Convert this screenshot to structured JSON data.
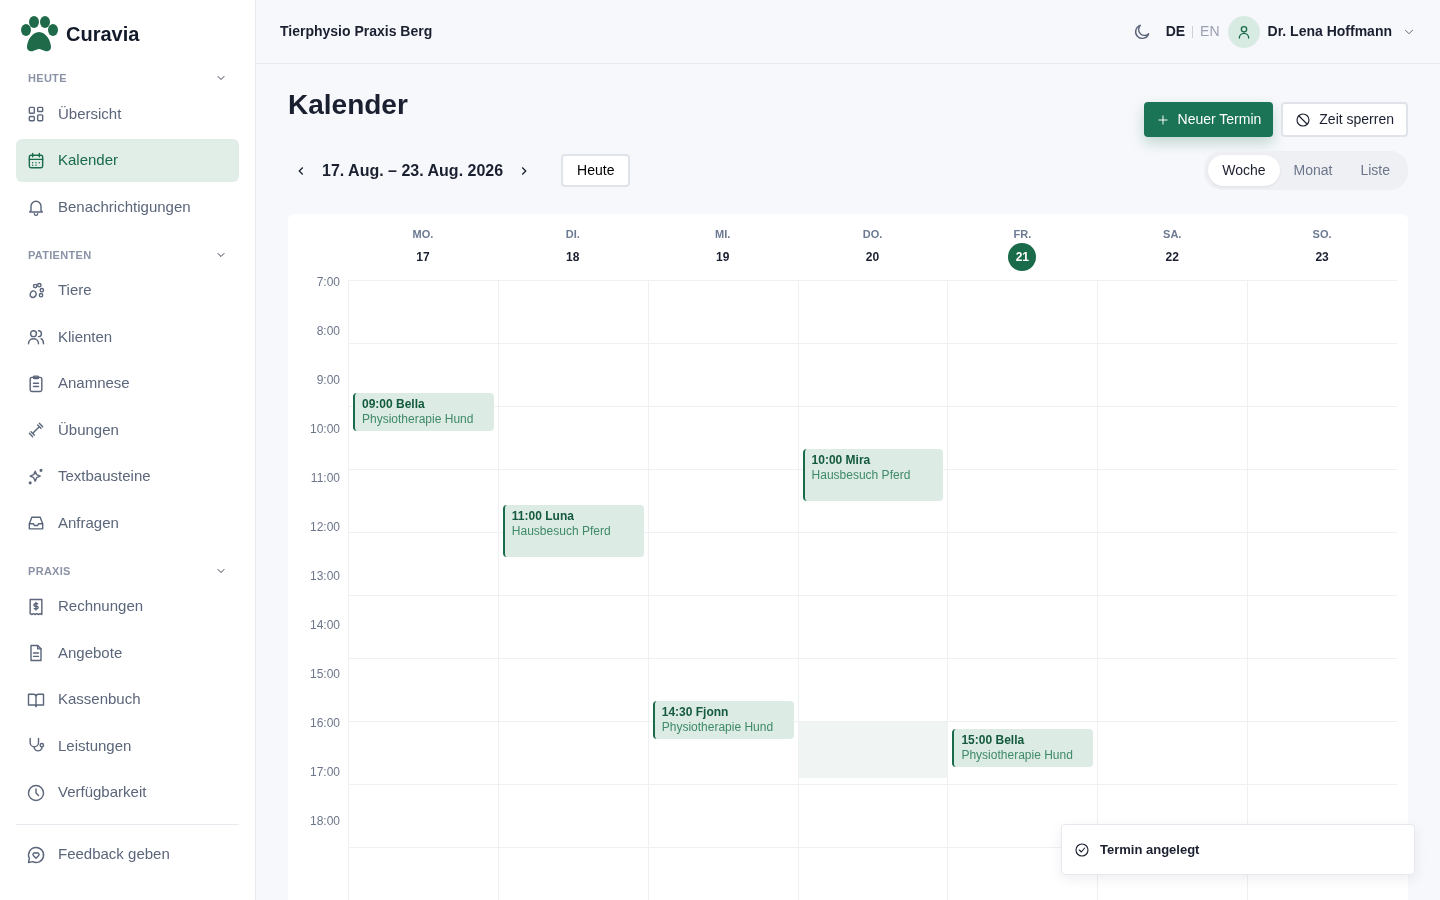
{
  "brand": {
    "name": "Curavia"
  },
  "sidebar": {
    "sections": [
      {
        "heading": "HEUTE",
        "expanded": true,
        "items": [
          {
            "label": "Übersicht",
            "selected": false
          },
          {
            "label": "Kalender",
            "selected": true
          },
          {
            "label": "Benachrichtigungen",
            "selected": false
          }
        ]
      },
      {
        "heading": "PATIENTEN",
        "expanded": true,
        "items": [
          {
            "label": "Tiere",
            "selected": false
          },
          {
            "label": "Klienten",
            "selected": false
          },
          {
            "label": "Anamnese",
            "selected": false
          },
          {
            "label": "Übungen",
            "selected": false
          },
          {
            "label": "Textbausteine",
            "selected": false
          },
          {
            "label": "Anfragen",
            "selected": false
          }
        ]
      },
      {
        "heading": "PRAXIS",
        "expanded": true,
        "items": [
          {
            "label": "Rechnungen",
            "selected": false
          },
          {
            "label": "Angebote",
            "selected": false
          },
          {
            "label": "Kassenbuch",
            "selected": false
          },
          {
            "label": "Leistungen",
            "selected": false
          },
          {
            "label": "Verfügbarkeit",
            "selected": false
          }
        ]
      }
    ],
    "footer_items": [
      {
        "label": "Feedback geben",
        "selected": false
      }
    ]
  },
  "header": {
    "practice": "Tierphysio Praxis Berg",
    "languages": [
      {
        "code": "DE",
        "selected": true
      },
      {
        "code": "EN",
        "selected": false
      }
    ],
    "user": "Dr. Lena Hoffmann"
  },
  "page": {
    "title": "Kalender",
    "actions": [
      {
        "label": "Neuer Termin",
        "kind": "primary"
      },
      {
        "label": "Zeit sperren",
        "kind": "outline"
      }
    ],
    "range": "17. Aug. – 23. Aug. 2026",
    "today_button": "Heute",
    "views": [
      {
        "label": "Woche",
        "selected": true
      },
      {
        "label": "Monat",
        "selected": false
      },
      {
        "label": "Liste",
        "selected": false
      }
    ]
  },
  "calendar": {
    "times": [
      "7:00",
      "8:00",
      "9:00",
      "10:00",
      "11:00",
      "12:00",
      "13:00",
      "14:00",
      "15:00",
      "16:00",
      "17:00",
      "18:00"
    ],
    "days": [
      {
        "name": "MO.",
        "date": "17",
        "today": false,
        "blocked": false,
        "events": [
          {
            "title": "09:00 Bella",
            "subtitle": "Physiotherapie Hund"
          }
        ]
      },
      {
        "name": "DI.",
        "date": "18",
        "today": false,
        "blocked": false,
        "events": [
          {
            "title": "11:00 Luna",
            "subtitle": "Hausbesuch Pferd"
          }
        ]
      },
      {
        "name": "MI.",
        "date": "19",
        "today": false,
        "blocked": false,
        "events": [
          {
            "title": "14:30 Fjonn",
            "subtitle": "Physiotherapie Hund"
          }
        ]
      },
      {
        "name": "DO.",
        "date": "20",
        "today": false,
        "blocked": true,
        "events": [
          {
            "title": "10:00 Mira",
            "subtitle": "Hausbesuch Pferd"
          }
        ]
      },
      {
        "name": "FR.",
        "date": "21",
        "today": true,
        "blocked": false,
        "events": [
          {
            "title": "15:00 Bella",
            "subtitle": "Physiotherapie Hund"
          }
        ]
      },
      {
        "name": "SA.",
        "date": "22",
        "today": false,
        "blocked": false
      },
      {
        "name": "SO.",
        "date": "23",
        "today": false,
        "blocked": false
      }
    ]
  },
  "toast": {
    "message": "Termin angelegt"
  }
}
